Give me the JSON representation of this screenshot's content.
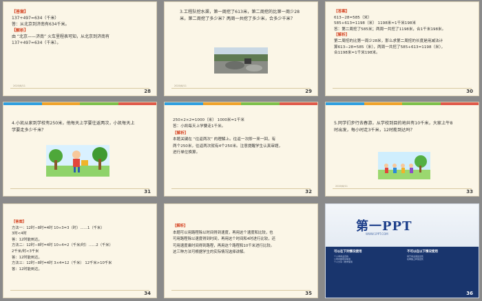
{
  "slides": [
    {
      "number": "28",
      "date": "2020/8/11",
      "answer_tag": "【答案】",
      "lines": [
        "137+497=634（千米）",
        "答：从北京到济南有634千米。"
      ],
      "analysis_tag": "【解析】",
      "analysis": [
        "由 “北京——济南” 火车里程表可知，从北京到济南有",
        "137+497=634（千米）。"
      ]
    },
    {
      "number": "29",
      "date": "2020/8/11",
      "question": [
        "3.工程队挖水渠，第一周挖了613米，第二周挖的比第一周少28",
        "米，第二周挖了多少米？两周一共挖了多少米，合多少千米？"
      ]
    },
    {
      "number": "30",
      "answer_tag": "【答案】",
      "lines": [
        "613−28=585（米）",
        "585+613=1198（米）     1198米≈1千米198米",
        "答：第二周挖了585米；两周一共挖了1198米，合1千米198米。"
      ],
      "analysis_tag": "【解析】",
      "analysis": [
        "第二周挖的比第一周少28米，那么求第二周挖的长度是用减法计",
        "算613−28=585（米），两周一共挖了585+613=1198（米），",
        "合1198米=1千米198米。"
      ]
    },
    {
      "number": "31",
      "question": [
        "4.小凯从家到学校有250米，他每天上学要往返两次，小凯每天上",
        "学要走多少千米？"
      ]
    },
    {
      "number": "32",
      "lines": [
        "250×2×2=1000（米）         1000米=1千米",
        "答：小凯每天上学要走1千米。"
      ],
      "analysis_tag": "【解析】",
      "analysis": [
        "本题关键在 “往返两次” 的理解上。往返一次即一来一回，有",
        "两个250米，往返两次就有4个250米。注意提醒学生认真审题，",
        "进行单位换算。"
      ]
    },
    {
      "number": "33",
      "date": "2020/8/11",
      "question": [
        "5.同学们步行去春游，从学校到目的地共有10千米，大家上午8",
        "时出发，每小时走3千米，12时能到达吗？"
      ]
    },
    {
      "number": "34",
      "answer_tag": "【答案】",
      "lines": [
        "方法一：12时−8时=4时    10÷3=3（时）……1（千米）",
        "3时<4时",
        "答：12时能到达。",
        "方法二：12时−8时=4时    10÷4=2（千米/时）……2（千米）",
        "2千米/时<3千米",
        "答：12时能到达。",
        "方法三：12时−8时=4时    3×4=12（千米）  12千米>10千米",
        "答：12时能到达。"
      ]
    },
    {
      "number": "35",
      "analysis_tag": "【解析】",
      "analysis": [
        "本题可以用路程除以时间得到速度，再用这个速度和比较，也",
        "可用路程除以速度得到时间，再用这个时间和4时进行比较，还",
        "可用速度乘时间得到路程，再用这个路程和10千米进行比较。",
        "这三种方法可根据学生的实际情况选择讲解。"
      ]
    },
    {
      "number": "36",
      "logo": "第一PPT",
      "logo_sub": "WWW.1PPT.COM",
      "col1_head": "可以在下列情况使用",
      "col1_text": [
        "个人非商业目的",
        "公司内部培训使用",
        "个人分享 / 教学使用"
      ],
      "col2_head": "不可以在以下情况使用",
      "col2_text": [
        "用于商业用途出售",
        "在网络上转载出售"
      ]
    }
  ],
  "colors": {
    "answer_tag": "#d4401f",
    "slide_bg": "#fbf6e7",
    "bar": [
      "#2f9fe0",
      "#f0a32a",
      "#7dc04a",
      "#e05a4a"
    ]
  }
}
